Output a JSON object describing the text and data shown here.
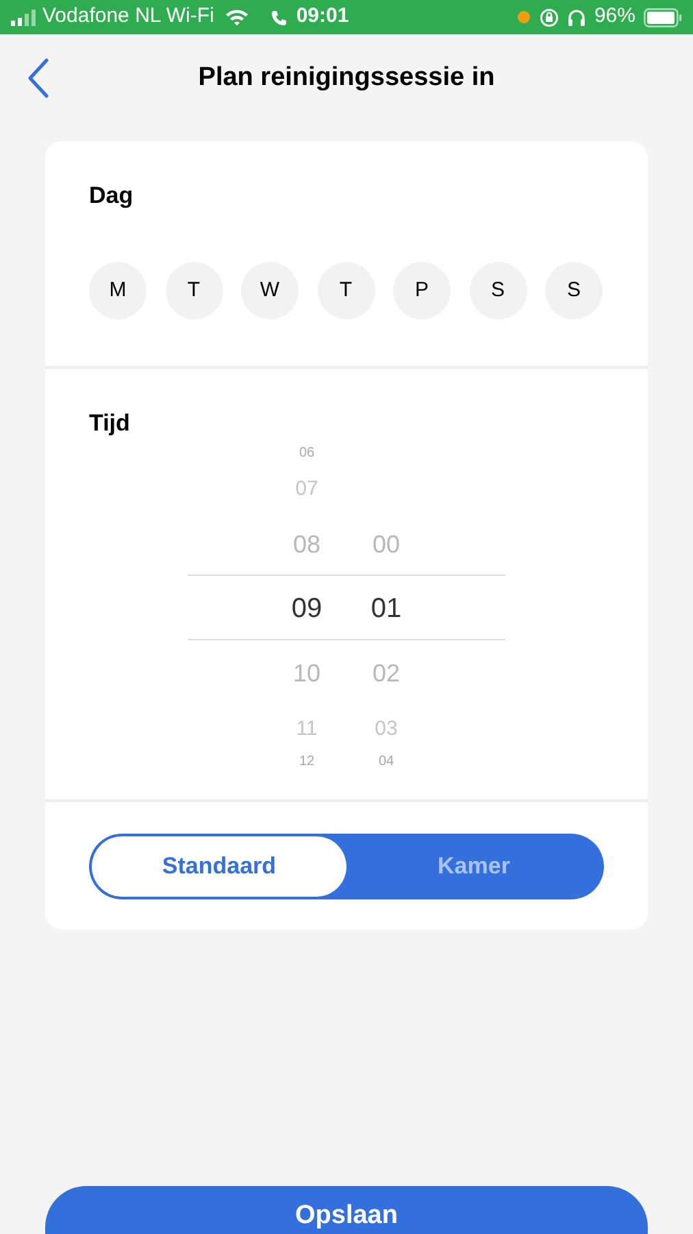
{
  "status_bar": {
    "carrier": "Vodafone NL Wi-Fi",
    "time": "09:01",
    "battery": "96%"
  },
  "header": {
    "title": "Plan reinigingssessie in"
  },
  "day_section": {
    "label": "Dag",
    "days": [
      {
        "label": "M",
        "selected": false
      },
      {
        "label": "T",
        "selected": false
      },
      {
        "label": "W",
        "selected": false
      },
      {
        "label": "T",
        "selected": false
      },
      {
        "label": "P",
        "selected": false
      },
      {
        "label": "S",
        "selected": false
      },
      {
        "label": "S",
        "selected": false
      }
    ]
  },
  "time_section": {
    "label": "Tijd",
    "columns": [
      {
        "items": [
          {
            "text": "06",
            "selected": false
          },
          {
            "text": "07",
            "selected": false
          },
          {
            "text": "08",
            "selected": false
          },
          {
            "text": "09",
            "selected": true
          },
          {
            "text": "10",
            "selected": false
          },
          {
            "text": "11",
            "selected": false
          },
          {
            "text": "12",
            "selected": false
          }
        ]
      },
      {
        "items": [
          {
            "text": "00",
            "selected": false
          },
          {
            "text": "01",
            "selected": true
          },
          {
            "text": "02",
            "selected": false
          },
          {
            "text": "03",
            "selected": false
          },
          {
            "text": "04",
            "selected": false
          }
        ]
      }
    ]
  },
  "mode_toggle": [
    {
      "label": "Standaard",
      "selected": true
    },
    {
      "label": "Kamer",
      "selected": false
    }
  ],
  "save_button": "Opslaan"
}
